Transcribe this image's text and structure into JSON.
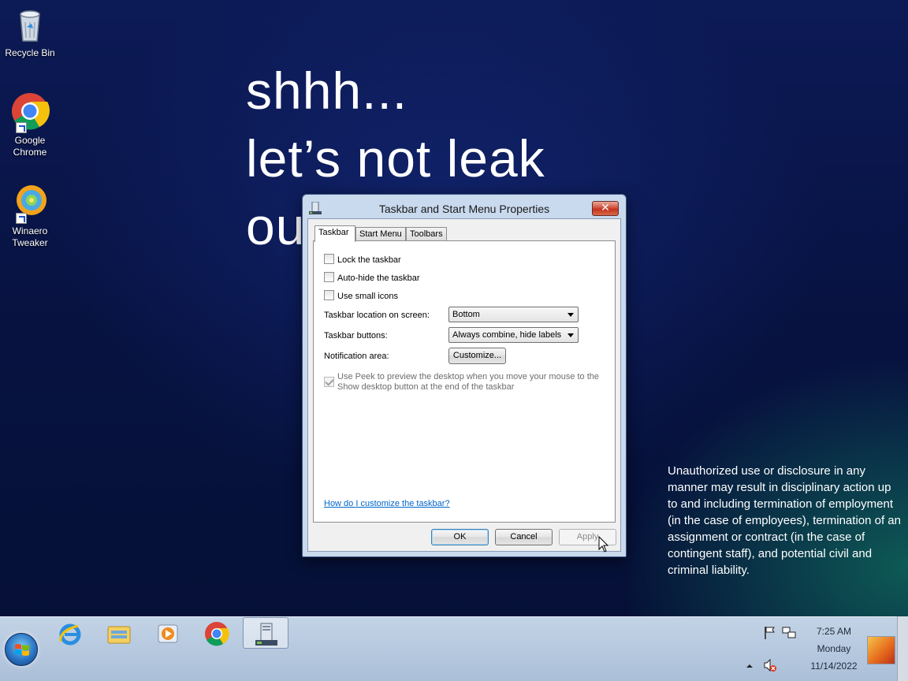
{
  "desktop": {
    "icons": [
      {
        "label_line1": "Recycle Bin",
        "label_line2": ""
      },
      {
        "label_line1": "Google",
        "label_line2": "Chrome"
      },
      {
        "label_line1": "Winaero",
        "label_line2": "Tweaker"
      }
    ],
    "wallpaper_lines": [
      "shhh...",
      "let’s not leak",
      "ou"
    ],
    "disclaimer": "Unauthorized use or disclosure in any manner may result in disciplinary action up to and including termination of employment (in the case of employees), termination of an assignment or contract (in the case of contingent staff), and potential civil and criminal liability."
  },
  "dialog": {
    "title": "Taskbar and Start Menu Properties",
    "close_label": "✕",
    "tabs": [
      "Taskbar",
      "Start Menu",
      "Toolbars"
    ],
    "active_tab": "Taskbar",
    "checkboxes": [
      {
        "label": "Lock the taskbar",
        "checked": false
      },
      {
        "label": "Auto-hide the taskbar",
        "checked": false
      },
      {
        "label": "Use small icons",
        "checked": false
      }
    ],
    "location_label": "Taskbar location on screen:",
    "location_value": "Bottom",
    "buttons_label": "Taskbar buttons:",
    "buttons_value": "Always combine, hide labels",
    "notification_label": "Notification area:",
    "customize_button": "Customize...",
    "peek_label": "Use Peek to preview the desktop when you move your mouse to the Show desktop button at the end of the taskbar",
    "peek_checked": true,
    "help_link": "How do I customize the taskbar?",
    "ok_button": "OK",
    "cancel_button": "Cancel",
    "apply_button": "Apply"
  },
  "taskbar": {
    "pinned": [
      "internet-explorer",
      "windows-explorer",
      "media-player",
      "google-chrome",
      "taskbar-properties"
    ],
    "clock_time": "7:25 AM",
    "clock_day": "Monday",
    "clock_date": "11/14/2022"
  },
  "colors": {
    "wallpaper": "#071240",
    "taskbar": "#b4c7dd",
    "link": "#0066cc",
    "close_button": "#c9402a"
  }
}
